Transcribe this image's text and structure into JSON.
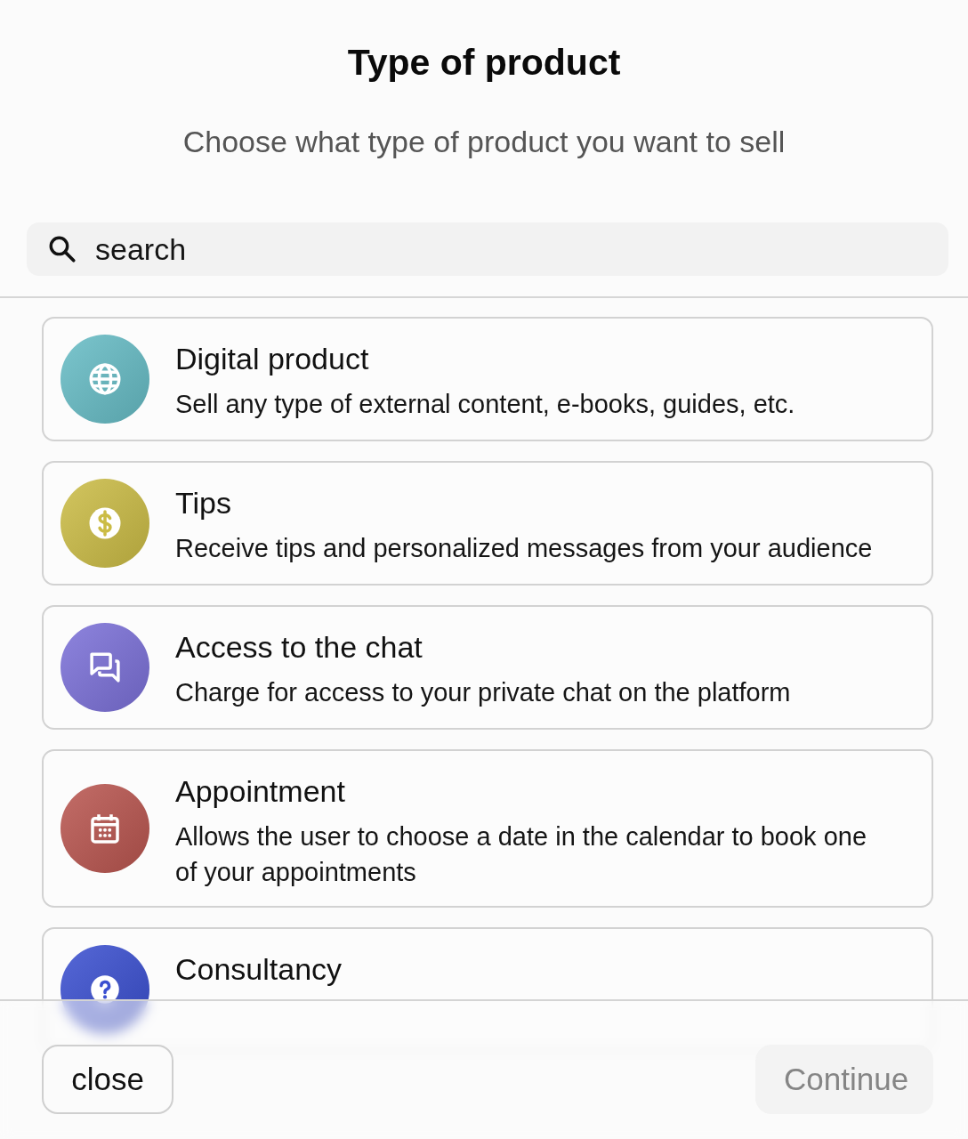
{
  "title": "Type of product",
  "subtitle": "Choose what type of product you want to sell",
  "search": {
    "placeholder": "search"
  },
  "products": [
    {
      "kind": "globe",
      "color": "#66bcc5",
      "title": "Digital product",
      "description": "Sell any type of external content, e-books, guides, etc."
    },
    {
      "kind": "dollar",
      "color": "#cbbc45",
      "title": "Tips",
      "description": "Receive tips and personalized messages from your audience"
    },
    {
      "kind": "chat",
      "color": "#7b70d8",
      "title": "Access to the chat",
      "description": "Charge for access to your private chat on the platform"
    },
    {
      "kind": "calendar",
      "color": "#b9554f",
      "title": "Appointment",
      "description": "Allows the user to choose a date in the calendar to book one of your appointments"
    },
    {
      "kind": "question",
      "color": "#3a4fd0",
      "title": "Consultancy"
    }
  ],
  "buttons": [
    {
      "kind": "outline",
      "label": "close",
      "disabled": false
    },
    {
      "kind": "primary",
      "label": "Continue",
      "disabled": true
    }
  ]
}
